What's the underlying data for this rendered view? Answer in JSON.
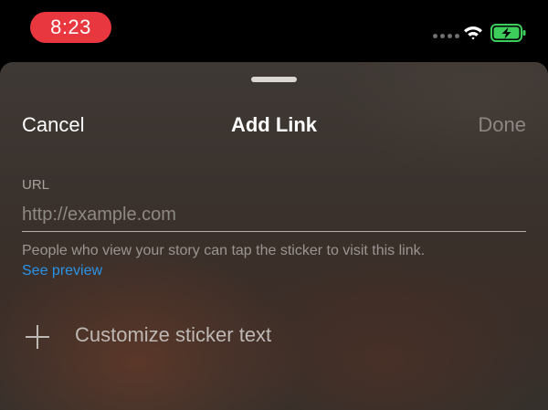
{
  "status_bar": {
    "time": "8:23",
    "time_pill_color": "#e8373f",
    "signal_icon": "cellular-signal-dots",
    "wifi_icon": "wifi-icon",
    "battery_icon": "battery-charging-icon",
    "battery_color": "#3ccd5b"
  },
  "sheet": {
    "nav": {
      "cancel_label": "Cancel",
      "title": "Add Link",
      "done_label": "Done"
    },
    "url_field": {
      "label": "URL",
      "value": "",
      "placeholder": "http://example.com"
    },
    "help_text": "People who view your story can tap the sticker to visit this link.",
    "see_preview_label": "See preview",
    "customize": {
      "icon": "plus-icon",
      "label": "Customize sticker text"
    },
    "link_color": "#2a93e8"
  }
}
